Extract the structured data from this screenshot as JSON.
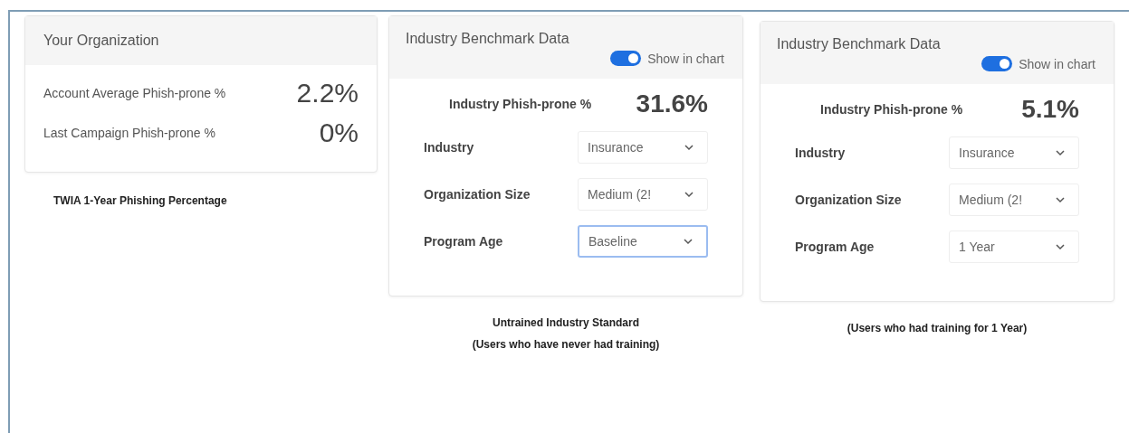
{
  "organization": {
    "title": "Your Organization",
    "stats": [
      {
        "label": "Account Average Phish-prone %",
        "value": "2.2%"
      },
      {
        "label": "Last Campaign Phish-prone %",
        "value": "0%"
      }
    ],
    "caption": "TWIA 1-Year Phishing Percentage"
  },
  "benchmarks": [
    {
      "title": "Industry Benchmark Data",
      "toggle": {
        "label": "Show in chart",
        "on": true
      },
      "stat": {
        "label": "Industry Phish-prone %",
        "value": "31.6%"
      },
      "fields": [
        {
          "label": "Industry",
          "value": "Insurance",
          "focused": false
        },
        {
          "label": "Organization Size",
          "value": "Medium (2!",
          "focused": false
        },
        {
          "label": "Program Age",
          "value": "Baseline",
          "focused": true
        }
      ],
      "captions": [
        "Untrained Industry Standard",
        "(Users who have never had training)"
      ]
    },
    {
      "title": "Industry Benchmark Data",
      "toggle": {
        "label": "Show in chart",
        "on": true
      },
      "stat": {
        "label": "Industry Phish-prone %",
        "value": "5.1%"
      },
      "fields": [
        {
          "label": "Industry",
          "value": "Insurance",
          "focused": false
        },
        {
          "label": "Organization Size",
          "value": "Medium (2!",
          "focused": false
        },
        {
          "label": "Program Age",
          "value": "1 Year",
          "focused": false
        }
      ],
      "captions": [
        "(Users who had training for 1 Year)"
      ]
    }
  ]
}
